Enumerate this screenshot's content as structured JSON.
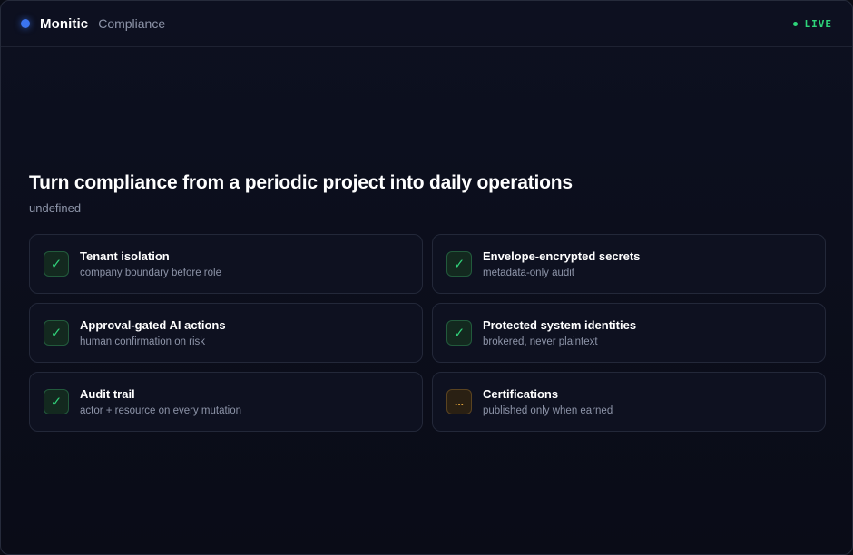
{
  "header": {
    "brand": "Monitic",
    "section": "Compliance",
    "live_label": "LIVE",
    "accent_color": "#3b74f0",
    "live_color": "#2ed57a"
  },
  "hero": {
    "title": "Turn compliance from a periodic project into daily operations",
    "subtitle": "undefined"
  },
  "controls": [
    {
      "title": "Tenant isolation",
      "detail": "company boundary before role",
      "status": "done",
      "icon": "check-icon",
      "glyph": "✓"
    },
    {
      "title": "Envelope-encrypted secrets",
      "detail": "metadata-only audit",
      "status": "done",
      "icon": "check-icon",
      "glyph": "✓"
    },
    {
      "title": "Approval-gated AI actions",
      "detail": "human confirmation on risk",
      "status": "done",
      "icon": "check-icon",
      "glyph": "✓"
    },
    {
      "title": "Protected system identities",
      "detail": "brokered, never plaintext",
      "status": "done",
      "icon": "check-icon",
      "glyph": "✓"
    },
    {
      "title": "Audit trail",
      "detail": "actor + resource on every mutation",
      "status": "done",
      "icon": "check-icon",
      "glyph": "✓"
    },
    {
      "title": "Certifications",
      "detail": "published only when earned",
      "status": "pending",
      "icon": "ellipsis-icon",
      "glyph": "..."
    }
  ]
}
